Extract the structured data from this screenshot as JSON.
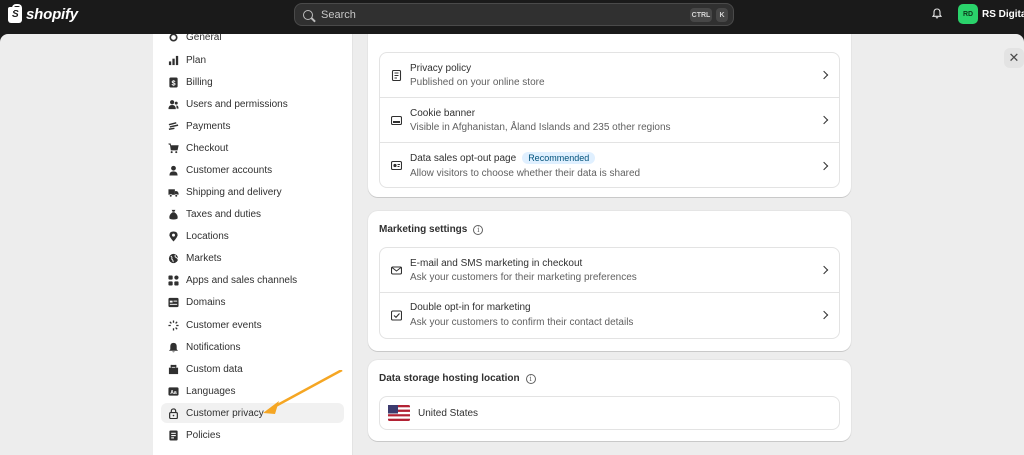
{
  "topbar": {
    "brand": "shopify",
    "search_placeholder": "Search",
    "shortcut_ctrl": "CTRL",
    "shortcut_k": "K",
    "user_initials": "RD",
    "user_name": "RS Digitals"
  },
  "sidebar": {
    "items": [
      {
        "label": "General",
        "icon": "gear-icon"
      },
      {
        "label": "Plan",
        "icon": "chart-icon"
      },
      {
        "label": "Billing",
        "icon": "dollar-icon"
      },
      {
        "label": "Users and permissions",
        "icon": "users-icon"
      },
      {
        "label": "Payments",
        "icon": "payments-icon"
      },
      {
        "label": "Checkout",
        "icon": "cart-icon"
      },
      {
        "label": "Customer accounts",
        "icon": "person-icon"
      },
      {
        "label": "Shipping and delivery",
        "icon": "truck-icon"
      },
      {
        "label": "Taxes and duties",
        "icon": "money-bag-icon"
      },
      {
        "label": "Locations",
        "icon": "location-icon"
      },
      {
        "label": "Markets",
        "icon": "globe-icon"
      },
      {
        "label": "Apps and sales channels",
        "icon": "apps-icon"
      },
      {
        "label": "Domains",
        "icon": "domain-icon"
      },
      {
        "label": "Customer events",
        "icon": "sparkle-icon"
      },
      {
        "label": "Notifications",
        "icon": "bell-icon"
      },
      {
        "label": "Custom data",
        "icon": "data-icon"
      },
      {
        "label": "Languages",
        "icon": "language-icon"
      },
      {
        "label": "Customer privacy",
        "icon": "lock-icon",
        "active": true
      },
      {
        "label": "Policies",
        "icon": "policy-icon"
      }
    ]
  },
  "privacy_card": {
    "rows": [
      {
        "title": "Privacy policy",
        "subtitle": "Published on your online store"
      },
      {
        "title": "Cookie banner",
        "subtitle": "Visible in Afghanistan, Åland Islands and 235 other regions"
      },
      {
        "title": "Data sales opt-out page",
        "badge": "Recommended",
        "subtitle": "Allow visitors to choose whether their data is shared"
      }
    ]
  },
  "marketing_card": {
    "title": "Marketing settings",
    "rows": [
      {
        "title": "E-mail and SMS marketing in checkout",
        "subtitle": "Ask your customers for their marketing preferences"
      },
      {
        "title": "Double opt-in for marketing",
        "subtitle": "Ask your customers to confirm their contact details"
      }
    ]
  },
  "storage_card": {
    "title": "Data storage hosting location",
    "country": "United States"
  },
  "colors": {
    "topbar": "#1a1a1a",
    "avatar": "#2ad36b",
    "annotation_arrow": "#f5a623",
    "badge_bg": "#e0f0ff"
  }
}
